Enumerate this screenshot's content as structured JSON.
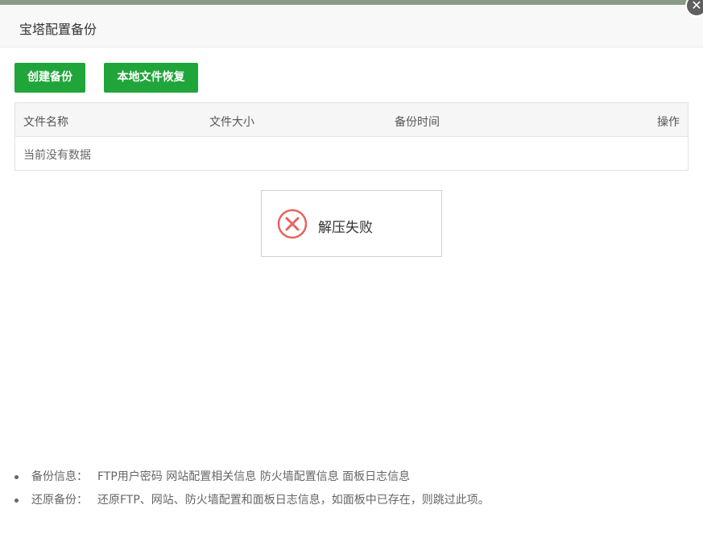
{
  "window": {
    "title": "宝塔配置备份"
  },
  "toolbar": {
    "create_label": "创建备份",
    "restore_label": "本地文件恢复"
  },
  "table": {
    "columns": [
      "文件名称",
      "文件大小",
      "备份时间",
      "操作"
    ],
    "empty_text": "当前没有数据"
  },
  "toast": {
    "message": "解压失败",
    "icon": "error-circle-icon",
    "icon_color": "#e8625e"
  },
  "notes": [
    {
      "label": "备份信息：",
      "text": "FTP用户密码 网站配置相关信息 防火墙配置信息 面板日志信息"
    },
    {
      "label": "还原备份：",
      "text": "还原FTP、网站、防火墙配置和面板日志信息，如面板中已存在，则跳过此项。"
    }
  ],
  "colors": {
    "primary": "#20a53a",
    "error": "#e8625e"
  },
  "close": {
    "icon": "close-icon",
    "glyph": "✕"
  }
}
